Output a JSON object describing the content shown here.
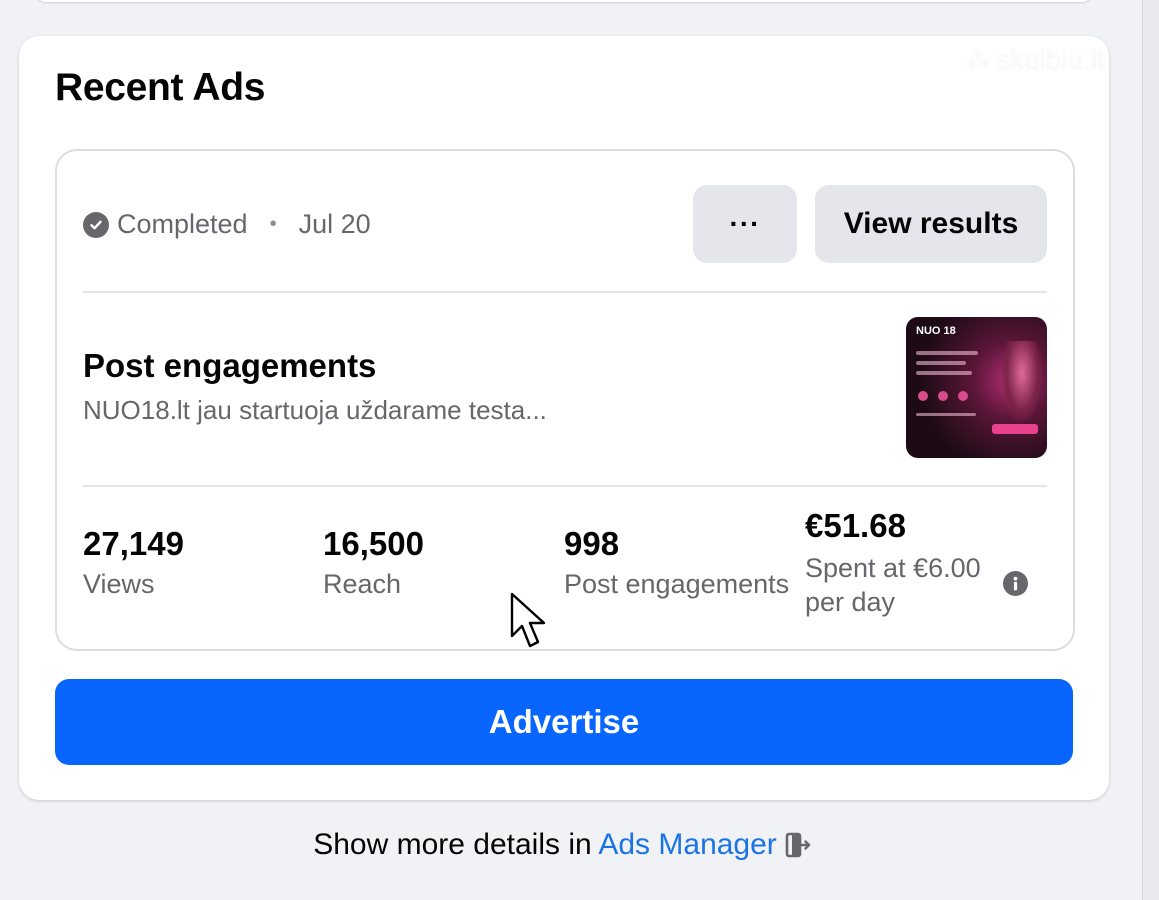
{
  "watermark": {
    "text": "skelbiu.lt"
  },
  "recent_ads": {
    "title": "Recent Ads",
    "ad": {
      "status": "Completed",
      "date": "Jul 20",
      "more_label": "···",
      "view_results_label": "View results",
      "objective": "Post engagements",
      "description": "NUO18.lt jau startuoja uždarame testa...",
      "thumbnail_brand": "NUO 18",
      "metrics": [
        {
          "value": "27,149",
          "label": "Views"
        },
        {
          "value": "16,500",
          "label": "Reach"
        },
        {
          "value": "998",
          "label": "Post engagements"
        }
      ],
      "spend": {
        "value": "€51.68",
        "label": "Spent at €6.00 per day"
      }
    },
    "advertise_label": "Advertise"
  },
  "footer": {
    "prefix": "Show more details in ",
    "link": "Ads Manager"
  },
  "colors": {
    "primary": "#0866ff",
    "link": "#1b74e4",
    "secondary_text": "#65676b",
    "button_gray": "#e4e6eb"
  }
}
